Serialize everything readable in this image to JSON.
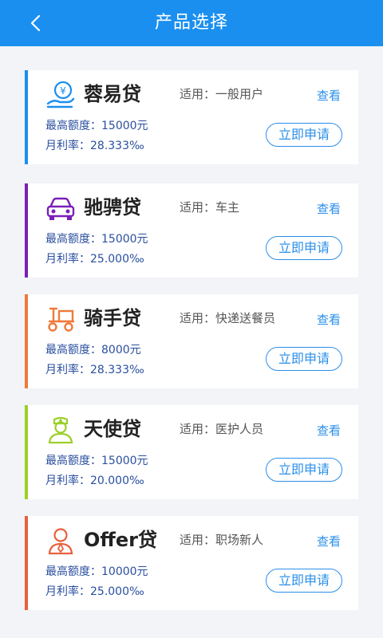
{
  "header": {
    "title": "产品选择",
    "back_icon": "chevron-left-icon"
  },
  "products": [
    {
      "name": "蓉易贷",
      "suit": "适用：一般用户",
      "view": "查看",
      "limit": "最高额度：15000元",
      "rate": "月利率：28.333‰",
      "apply": "立即申请",
      "icon": "money-hand-icon",
      "color": "#1a8ff0"
    },
    {
      "name": "驰骋贷",
      "suit": "适用：车主",
      "view": "查看",
      "limit": "最高额度：15000元",
      "rate": "月利率：25.000‰",
      "apply": "立即申请",
      "icon": "car-icon",
      "color": "#7a1fb8"
    },
    {
      "name": "骑手贷",
      "suit": "适用：快递送餐员",
      "view": "查看",
      "limit": "最高额度：8000元",
      "rate": "月利率：28.333‰",
      "apply": "立即申请",
      "icon": "scooter-icon",
      "color": "#f07a3a"
    },
    {
      "name": "天使贷",
      "suit": "适用：医护人员",
      "view": "查看",
      "limit": "最高额度：15000元",
      "rate": "月利率：20.000‰",
      "apply": "立即申请",
      "icon": "nurse-icon",
      "color": "#9ccf2a"
    },
    {
      "name": "Offer贷",
      "suit": "适用：职场新人",
      "view": "查看",
      "limit": "最高额度：10000元",
      "rate": "月利率：25.000‰",
      "apply": "立即申请",
      "icon": "newcomer-icon",
      "color": "#e8603c"
    }
  ]
}
